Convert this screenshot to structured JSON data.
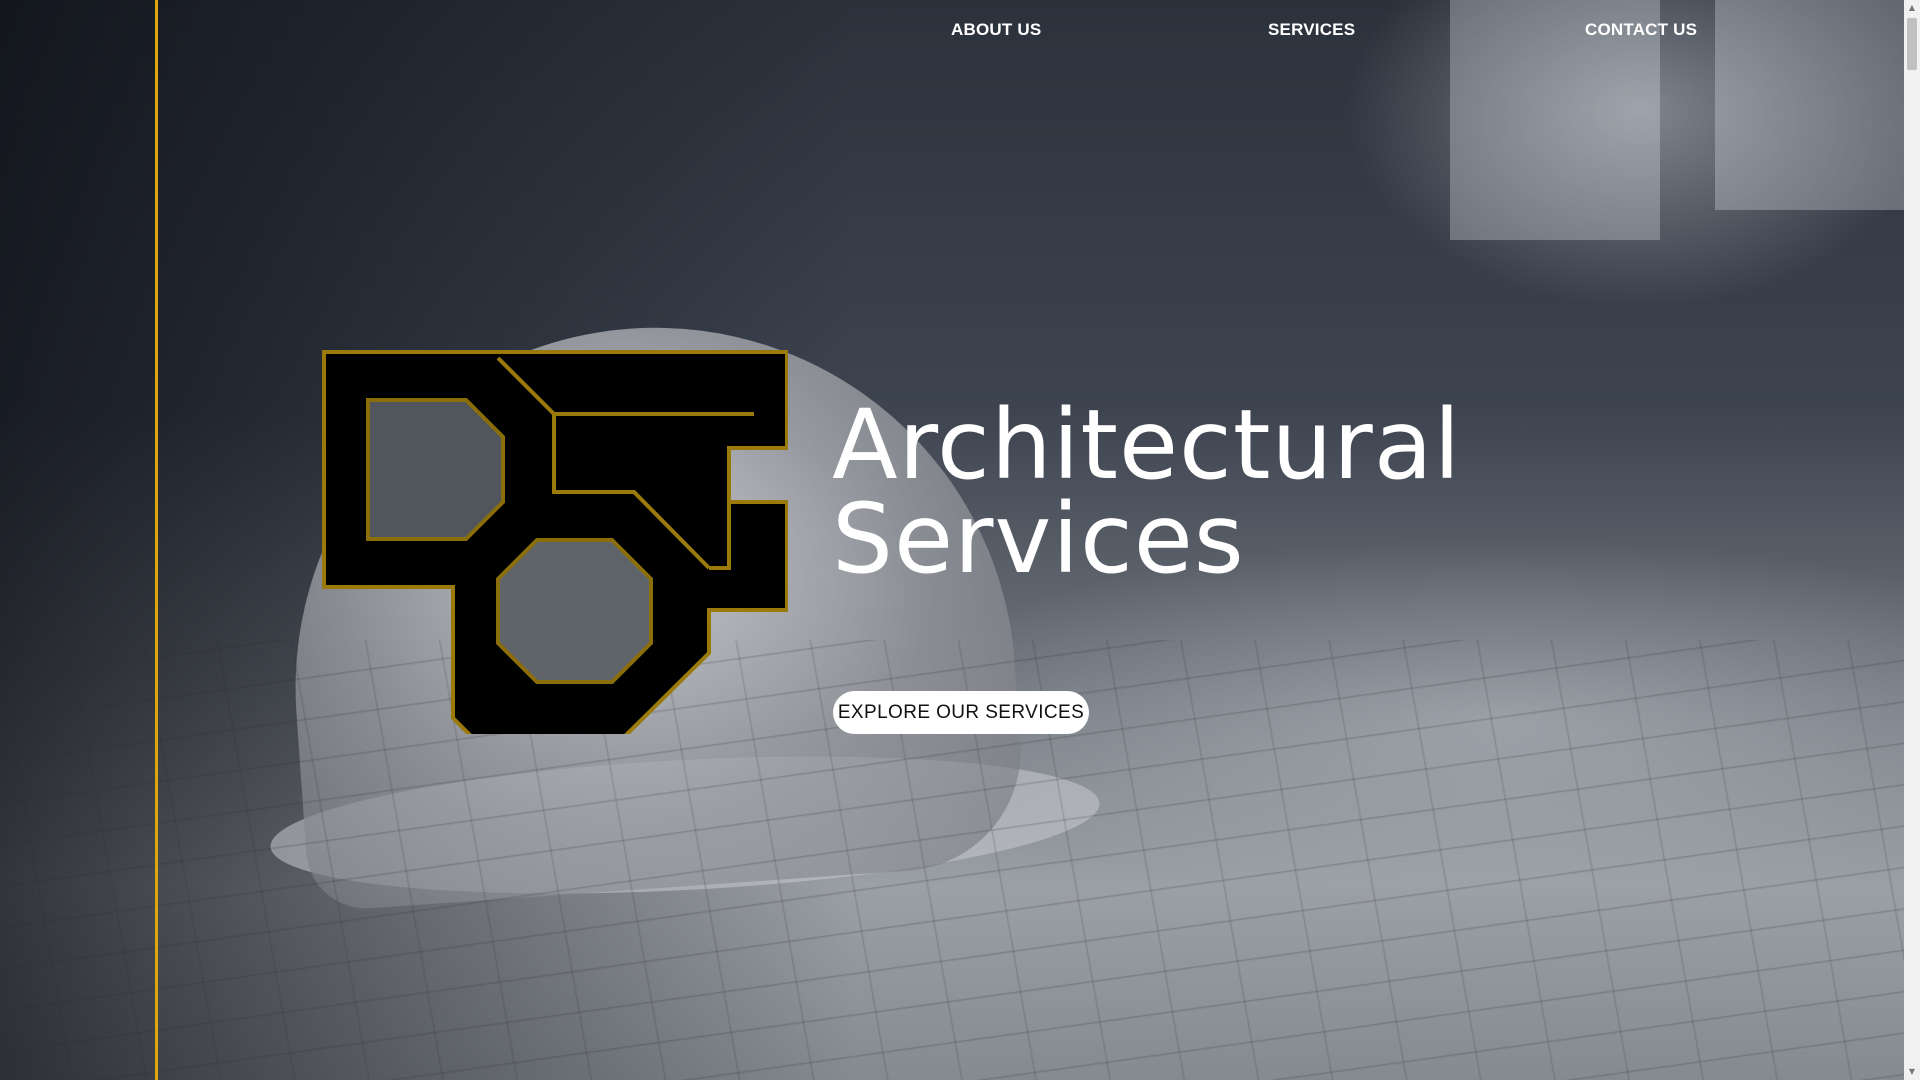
{
  "nav": {
    "items": [
      {
        "label": "ABOUT US"
      },
      {
        "label": "SERVICES"
      },
      {
        "label": "CONTACT US"
      }
    ]
  },
  "hero": {
    "headline_line1": "Architectural",
    "headline_line2": "Services",
    "cta_label": "EXPLORE OUR SERVICES"
  },
  "colors": {
    "accent": "#e0a50e",
    "logo_gold": "#9a7a0b",
    "logo_fill": "#000000",
    "text": "#ffffff"
  },
  "icons": {
    "logo": "company-monogram-logo",
    "scroll_up": "scroll-up-arrow-icon",
    "scroll_down": "scroll-down-arrow-icon"
  }
}
